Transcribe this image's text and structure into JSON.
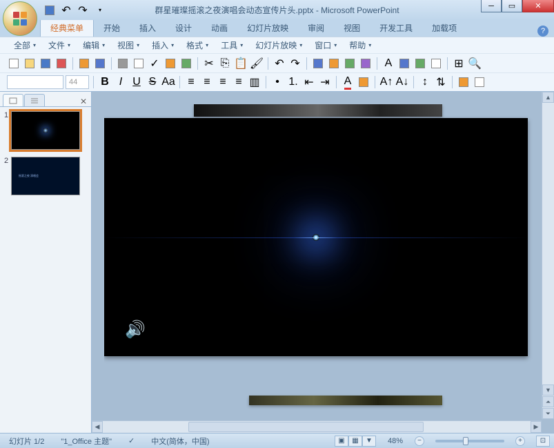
{
  "titlebar": {
    "title": "群星璀璨摇滚之夜演唱会动态宣传片头.pptx - Microsoft PowerPoint"
  },
  "ribbon": {
    "tabs": [
      "经典菜单",
      "开始",
      "插入",
      "设计",
      "动画",
      "幻灯片放映",
      "审阅",
      "视图",
      "开发工具",
      "加载项"
    ],
    "active": 0
  },
  "menubar": {
    "items": [
      "全部",
      "文件",
      "编辑",
      "视图",
      "插入",
      "格式",
      "工具",
      "幻灯片放映",
      "窗口",
      "帮助"
    ]
  },
  "fontbar": {
    "font_placeholder": "",
    "size_placeholder": "44"
  },
  "slides": {
    "items": [
      {
        "num": "1",
        "active": true
      },
      {
        "num": "2",
        "active": false
      }
    ]
  },
  "statusbar": {
    "slide_info": "幻灯片 1/2",
    "theme": "\"1_Office 主题\"",
    "language": "中文(简体，中国)",
    "zoom": "48%"
  }
}
